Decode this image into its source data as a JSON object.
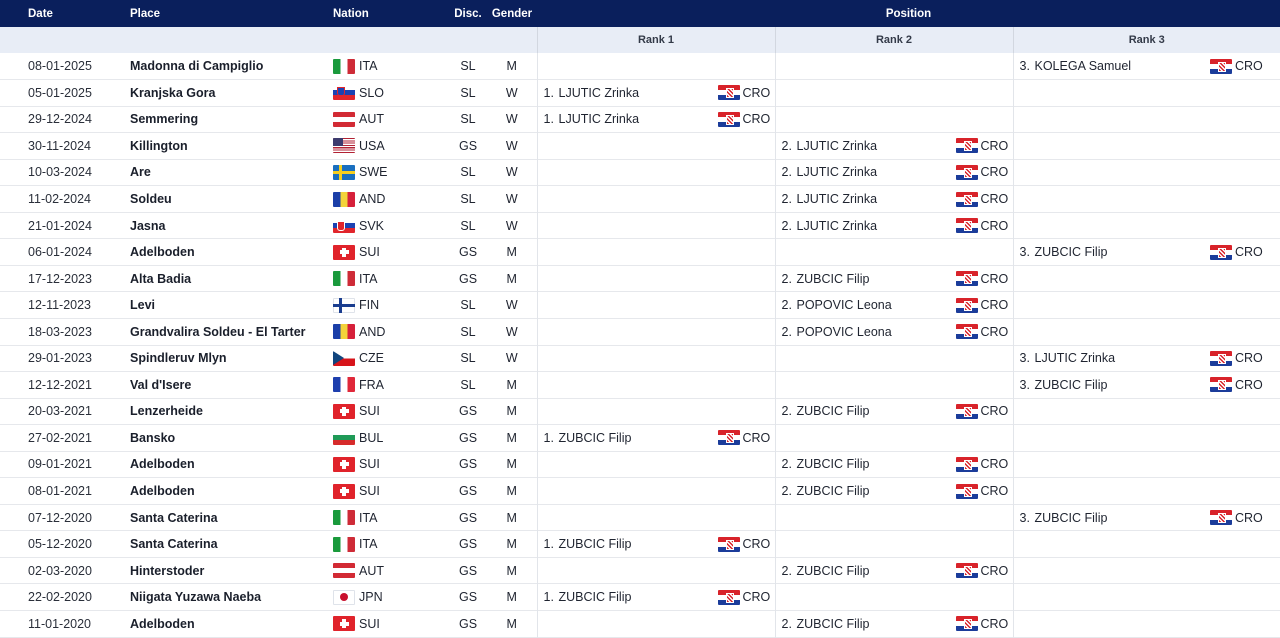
{
  "header": {
    "date": "Date",
    "place": "Place",
    "nation": "Nation",
    "disc": "Disc.",
    "gender": "Gender",
    "position": "Position",
    "rank1": "Rank 1",
    "rank2": "Rank 2",
    "rank3": "Rank 3"
  },
  "rows": [
    {
      "date": "08-01-2025",
      "place": "Madonna di Campiglio",
      "nation": "ITA",
      "flag": "ita",
      "disc": "SL",
      "gender": "M",
      "rank": 3,
      "pos": "3.",
      "athlete": "KOLEGA Samuel",
      "country": "CRO"
    },
    {
      "date": "05-01-2025",
      "place": "Kranjska Gora",
      "nation": "SLO",
      "flag": "slo",
      "disc": "SL",
      "gender": "W",
      "rank": 1,
      "pos": "1.",
      "athlete": "LJUTIC Zrinka",
      "country": "CRO"
    },
    {
      "date": "29-12-2024",
      "place": "Semmering",
      "nation": "AUT",
      "flag": "aut",
      "disc": "SL",
      "gender": "W",
      "rank": 1,
      "pos": "1.",
      "athlete": "LJUTIC Zrinka",
      "country": "CRO"
    },
    {
      "date": "30-11-2024",
      "place": "Killington",
      "nation": "USA",
      "flag": "usa",
      "disc": "GS",
      "gender": "W",
      "rank": 2,
      "pos": "2.",
      "athlete": "LJUTIC Zrinka",
      "country": "CRO"
    },
    {
      "date": "10-03-2024",
      "place": "Are",
      "nation": "SWE",
      "flag": "swe",
      "disc": "SL",
      "gender": "W",
      "rank": 2,
      "pos": "2.",
      "athlete": "LJUTIC Zrinka",
      "country": "CRO"
    },
    {
      "date": "11-02-2024",
      "place": "Soldeu",
      "nation": "AND",
      "flag": "and",
      "disc": "SL",
      "gender": "W",
      "rank": 2,
      "pos": "2.",
      "athlete": "LJUTIC Zrinka",
      "country": "CRO"
    },
    {
      "date": "21-01-2024",
      "place": "Jasna",
      "nation": "SVK",
      "flag": "svk",
      "disc": "SL",
      "gender": "W",
      "rank": 2,
      "pos": "2.",
      "athlete": "LJUTIC Zrinka",
      "country": "CRO"
    },
    {
      "date": "06-01-2024",
      "place": "Adelboden",
      "nation": "SUI",
      "flag": "sui",
      "disc": "GS",
      "gender": "M",
      "rank": 3,
      "pos": "3.",
      "athlete": "ZUBCIC Filip",
      "country": "CRO"
    },
    {
      "date": "17-12-2023",
      "place": "Alta Badia",
      "nation": "ITA",
      "flag": "ita",
      "disc": "GS",
      "gender": "M",
      "rank": 2,
      "pos": "2.",
      "athlete": "ZUBCIC Filip",
      "country": "CRO"
    },
    {
      "date": "12-11-2023",
      "place": "Levi",
      "nation": "FIN",
      "flag": "fin",
      "disc": "SL",
      "gender": "W",
      "rank": 2,
      "pos": "2.",
      "athlete": "POPOVIC Leona",
      "country": "CRO"
    },
    {
      "date": "18-03-2023",
      "place": "Grandvalira Soldeu - El Tarter",
      "nation": "AND",
      "flag": "and",
      "disc": "SL",
      "gender": "W",
      "rank": 2,
      "pos": "2.",
      "athlete": "POPOVIC Leona",
      "country": "CRO"
    },
    {
      "date": "29-01-2023",
      "place": "Spindleruv Mlyn",
      "nation": "CZE",
      "flag": "cze",
      "disc": "SL",
      "gender": "W",
      "rank": 3,
      "pos": "3.",
      "athlete": "LJUTIC Zrinka",
      "country": "CRO"
    },
    {
      "date": "12-12-2021",
      "place": "Val d'Isere",
      "nation": "FRA",
      "flag": "fra",
      "disc": "SL",
      "gender": "M",
      "rank": 3,
      "pos": "3.",
      "athlete": "ZUBCIC Filip",
      "country": "CRO"
    },
    {
      "date": "20-03-2021",
      "place": "Lenzerheide",
      "nation": "SUI",
      "flag": "sui",
      "disc": "GS",
      "gender": "M",
      "rank": 2,
      "pos": "2.",
      "athlete": "ZUBCIC Filip",
      "country": "CRO"
    },
    {
      "date": "27-02-2021",
      "place": "Bansko",
      "nation": "BUL",
      "flag": "bul",
      "disc": "GS",
      "gender": "M",
      "rank": 1,
      "pos": "1.",
      "athlete": "ZUBCIC Filip",
      "country": "CRO"
    },
    {
      "date": "09-01-2021",
      "place": "Adelboden",
      "nation": "SUI",
      "flag": "sui",
      "disc": "GS",
      "gender": "M",
      "rank": 2,
      "pos": "2.",
      "athlete": "ZUBCIC Filip",
      "country": "CRO"
    },
    {
      "date": "08-01-2021",
      "place": "Adelboden",
      "nation": "SUI",
      "flag": "sui",
      "disc": "GS",
      "gender": "M",
      "rank": 2,
      "pos": "2.",
      "athlete": "ZUBCIC Filip",
      "country": "CRO"
    },
    {
      "date": "07-12-2020",
      "place": "Santa Caterina",
      "nation": "ITA",
      "flag": "ita",
      "disc": "GS",
      "gender": "M",
      "rank": 3,
      "pos": "3.",
      "athlete": "ZUBCIC Filip",
      "country": "CRO"
    },
    {
      "date": "05-12-2020",
      "place": "Santa Caterina",
      "nation": "ITA",
      "flag": "ita",
      "disc": "GS",
      "gender": "M",
      "rank": 1,
      "pos": "1.",
      "athlete": "ZUBCIC Filip",
      "country": "CRO"
    },
    {
      "date": "02-03-2020",
      "place": "Hinterstoder",
      "nation": "AUT",
      "flag": "aut",
      "disc": "GS",
      "gender": "M",
      "rank": 2,
      "pos": "2.",
      "athlete": "ZUBCIC Filip",
      "country": "CRO"
    },
    {
      "date": "22-02-2020",
      "place": "Niigata Yuzawa Naeba",
      "nation": "JPN",
      "flag": "jpn",
      "disc": "GS",
      "gender": "M",
      "rank": 1,
      "pos": "1.",
      "athlete": "ZUBCIC Filip",
      "country": "CRO"
    },
    {
      "date": "11-01-2020",
      "place": "Adelboden",
      "nation": "SUI",
      "flag": "sui",
      "disc": "GS",
      "gender": "M",
      "rank": 2,
      "pos": "2.",
      "athlete": "ZUBCIC Filip",
      "country": "CRO"
    }
  ]
}
